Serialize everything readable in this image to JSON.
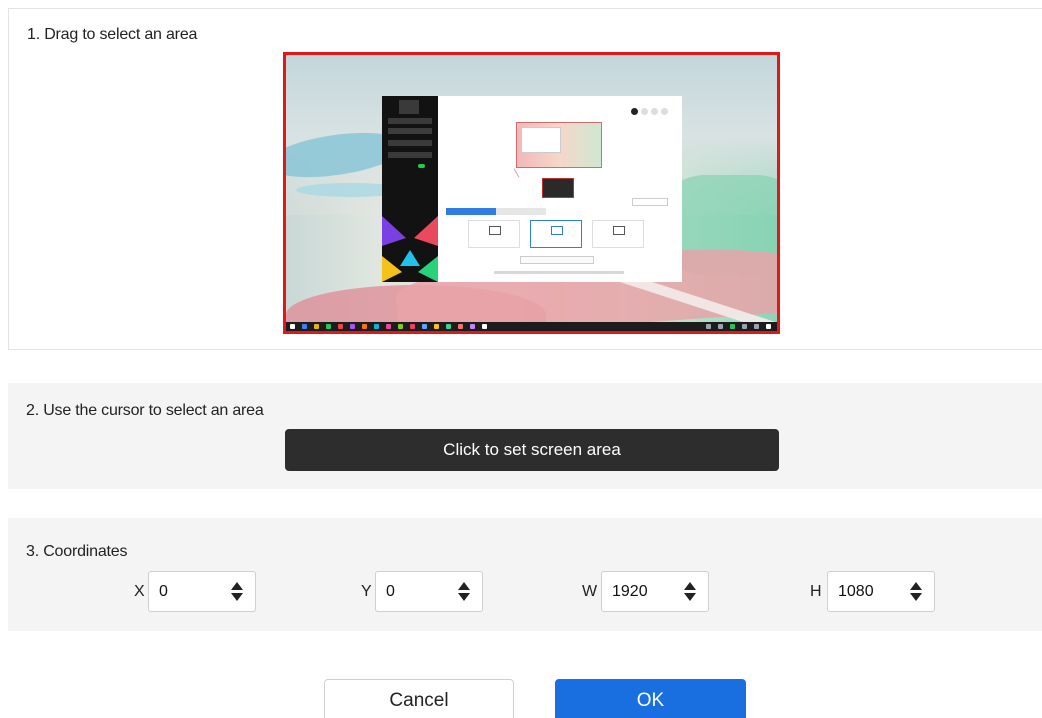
{
  "section1": {
    "title": "1. Drag to select an area"
  },
  "section2": {
    "title": "2. Use the cursor to select an area",
    "button_label": "Click to set screen area"
  },
  "section3": {
    "title": "3. Coordinates",
    "fields": [
      {
        "label": "X",
        "value": "0"
      },
      {
        "label": "Y",
        "value": "0"
      },
      {
        "label": "W",
        "value": "1920"
      },
      {
        "label": "H",
        "value": "1080"
      }
    ]
  },
  "footer": {
    "cancel_label": "Cancel",
    "ok_label": "OK"
  },
  "colors": {
    "selection_border": "#e01818",
    "primary": "#1a6fe0",
    "dark_button": "#2d2d2d",
    "section_bg": "#f4f4f4"
  }
}
